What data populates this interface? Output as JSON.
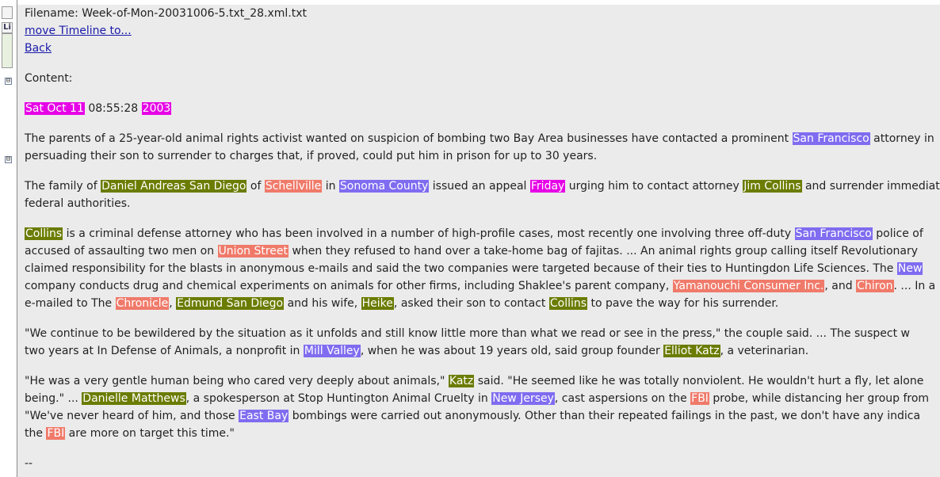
{
  "colors": {
    "date_highlight": "#e600e6",
    "person_highlight": "#6b7c00",
    "place_highlight": "#7f6cf0",
    "org_highlight": "#f07a6a",
    "content_background": "#ebebeb",
    "link_color": "#1a1aaa"
  },
  "header": {
    "filename": "Filename: Week-of-Mon-20031006-5.txt_28.xml.txt",
    "move_timeline_link": "move Timeline to...",
    "back_link": "Back",
    "content_label": "Content:"
  },
  "gutter": {
    "label_li": "Li",
    "tree_toggle_1": "⊟",
    "tree_toggle_2": "⊟"
  },
  "dateline": [
    {
      "text": "Sat Oct 11",
      "tag": "date"
    },
    {
      "text": " 08:55:28 "
    },
    {
      "text": "2003",
      "tag": "date"
    }
  ],
  "paragraphs": [
    [
      [
        {
          "text": "The parents of a 25-year-old animal rights activist wanted on suspicion of bombing two Bay Area businesses have contacted a prominent "
        },
        {
          "text": "San Francisco",
          "tag": "place"
        },
        {
          "text": " attorney in"
        }
      ],
      [
        {
          "text": "persuading their son to surrender to charges that, if proved, could put him in prison for up to 30 years."
        }
      ]
    ],
    [
      [
        {
          "text": "The family of "
        },
        {
          "text": "Daniel Andreas San Diego",
          "tag": "person"
        },
        {
          "text": " of "
        },
        {
          "text": "Schellville",
          "tag": "org"
        },
        {
          "text": " in "
        },
        {
          "text": "Sonoma County",
          "tag": "place"
        },
        {
          "text": " issued an appeal "
        },
        {
          "text": "Friday",
          "tag": "date"
        },
        {
          "text": " urging him to contact attorney "
        },
        {
          "text": "Jim Collins",
          "tag": "person"
        },
        {
          "text": " and surrender immediately"
        }
      ],
      [
        {
          "text": "federal authorities."
        }
      ]
    ],
    [
      [
        {
          "text": "Collins",
          "tag": "person"
        },
        {
          "text": " is a criminal defense attorney who has been involved in a number of high-profile cases, most recently one involving three off-duty "
        },
        {
          "text": "San Francisco",
          "tag": "place"
        },
        {
          "text": " police of"
        }
      ],
      [
        {
          "text": "accused of assaulting two men on "
        },
        {
          "text": "Union Street",
          "tag": "org"
        },
        {
          "text": " when they refused to hand over a take-home bag of fajitas. ... An animal rights group calling itself Revolutionary"
        }
      ],
      [
        {
          "text": "claimed responsibility for the blasts in anonymous e-mails and said the two companies were targeted because of their ties to Huntingdon Life Sciences. The "
        },
        {
          "text": "New",
          "tag": "place"
        }
      ],
      [
        {
          "text": "company conducts drug and chemical experiments on animals for other firms, including Shaklee's parent company, "
        },
        {
          "text": "Yamanouchi Consumer Inc.",
          "tag": "org"
        },
        {
          "text": ", and "
        },
        {
          "text": "Chiron",
          "tag": "org"
        },
        {
          "text": ". ... In a"
        }
      ],
      [
        {
          "text": "e-mailed to The "
        },
        {
          "text": "Chronicle",
          "tag": "org"
        },
        {
          "text": ", "
        },
        {
          "text": "Edmund San Diego",
          "tag": "person"
        },
        {
          "text": " and his wife, "
        },
        {
          "text": "Heike",
          "tag": "person"
        },
        {
          "text": ", asked their son to contact "
        },
        {
          "text": "Collins",
          "tag": "person"
        },
        {
          "text": " to pave the way for his surrender."
        }
      ]
    ],
    [
      [
        {
          "text": "\"We continue to be bewildered by the situation as it unfolds and still know little more than what we read or see in the press,\" the couple said. ... The suspect w"
        }
      ],
      [
        {
          "text": "two years at In Defense of Animals, a nonprofit in "
        },
        {
          "text": "Mill Valley",
          "tag": "place"
        },
        {
          "text": ", when he was about 19 years old, said group founder "
        },
        {
          "text": "Elliot Katz",
          "tag": "person"
        },
        {
          "text": ", a veterinarian."
        }
      ]
    ],
    [
      [
        {
          "text": "\"He was a very gentle human being who cared very deeply about animals,\" "
        },
        {
          "text": "Katz",
          "tag": "person"
        },
        {
          "text": " said. \"He seemed like he was totally nonviolent. He wouldn't hurt a fly, let alone"
        }
      ],
      [
        {
          "text": "being.\" ... "
        },
        {
          "text": "Danielle Matthews",
          "tag": "person"
        },
        {
          "text": ", a spokesperson at Stop Huntington Animal Cruelty in "
        },
        {
          "text": "New Jersey",
          "tag": "place"
        },
        {
          "text": ", cast aspersions on the "
        },
        {
          "text": "FBI",
          "tag": "org"
        },
        {
          "text": " probe, while distancing her group from"
        }
      ],
      [
        {
          "text": "\"We've never heard of him, and those "
        },
        {
          "text": "East Bay",
          "tag": "place"
        },
        {
          "text": " bombings were carried out anonymously. Other than their repeated failings in the past, we don't have any indica"
        }
      ],
      [
        {
          "text": "the "
        },
        {
          "text": "FBI",
          "tag": "org"
        },
        {
          "text": " are more on target this time.\""
        }
      ]
    ]
  ],
  "footer_text": "--"
}
